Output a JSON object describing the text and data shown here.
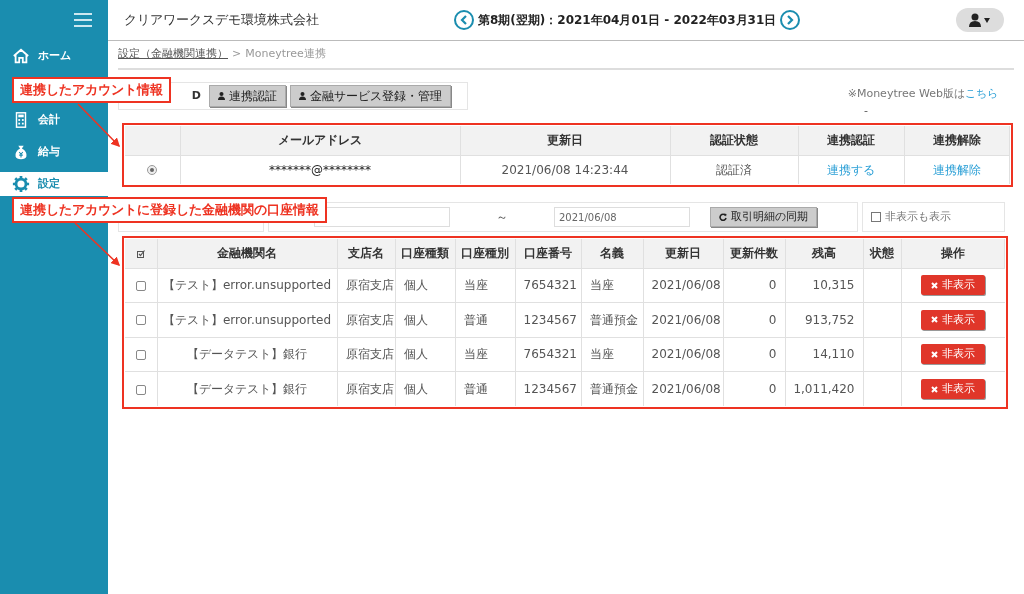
{
  "header": {
    "company": "クリアワークスデモ環境株式会社",
    "period": "第8期(翌期)：2021年04月01日 - 2022年03月31日"
  },
  "sidebar": {
    "items": [
      {
        "label": "ホーム",
        "selected": false
      },
      {
        "label": "会計",
        "selected": false
      },
      {
        "label": "給与",
        "selected": false
      },
      {
        "label": "設定",
        "selected": true
      }
    ]
  },
  "breadcrumb": {
    "link": "設定（金融機関連携）",
    "separator": ">",
    "current": "Moneytree連携"
  },
  "toolbar": {
    "label": "D",
    "buttons": [
      "連携認証",
      "金融サービス登録・管理"
    ]
  },
  "web_note": {
    "text": "※Moneytree Web版は",
    "link": "こちら",
    "dash": "-"
  },
  "account_table": {
    "columns": [
      "メールアドレス",
      "更新日",
      "認証状態",
      "連携認証",
      "連携解除"
    ],
    "rows": [
      {
        "selected": true,
        "email": "*******@********",
        "updated": "2021/06/08 14:23:44",
        "status": "認証済",
        "connect": "連携する",
        "disconnect": "連携解除"
      }
    ]
  },
  "filter": {
    "to_date": "2021/06/08",
    "tilde": "～",
    "sync_button": "取引明細の同期",
    "show_hidden": {
      "label": "非表示も表示",
      "checked": false
    }
  },
  "bank_table": {
    "columns": [
      "金融機関名",
      "支店名",
      "口座種類",
      "口座種別",
      "口座番号",
      "名義",
      "更新日",
      "更新件数",
      "残高",
      "状態",
      "操作"
    ],
    "rows": [
      {
        "checked": false,
        "cells": [
          "【テスト】error.unsupported",
          "原宿支店",
          "個人",
          "当座",
          "7654321",
          "当座",
          "2021/06/08",
          "0",
          "10,315",
          ""
        ],
        "action": "非表示"
      },
      {
        "checked": false,
        "cells": [
          "【テスト】error.unsupported",
          "原宿支店",
          "個人",
          "普通",
          "1234567",
          "普通預金",
          "2021/06/08",
          "0",
          "913,752",
          ""
        ],
        "action": "非表示"
      },
      {
        "checked": false,
        "cells": [
          "【データテスト】銀行",
          "原宿支店",
          "個人",
          "当座",
          "7654321",
          "当座",
          "2021/06/08",
          "0",
          "14,110",
          ""
        ],
        "action": "非表示"
      },
      {
        "checked": false,
        "cells": [
          "【データテスト】銀行",
          "原宿支店",
          "個人",
          "普通",
          "1234567",
          "普通預金",
          "2021/06/08",
          "0",
          "1,011,420",
          ""
        ],
        "action": "非表示"
      }
    ]
  },
  "callouts": [
    "連携したアカウント情報",
    "連携したアカウントに登録した金融機関の口座情報"
  ]
}
